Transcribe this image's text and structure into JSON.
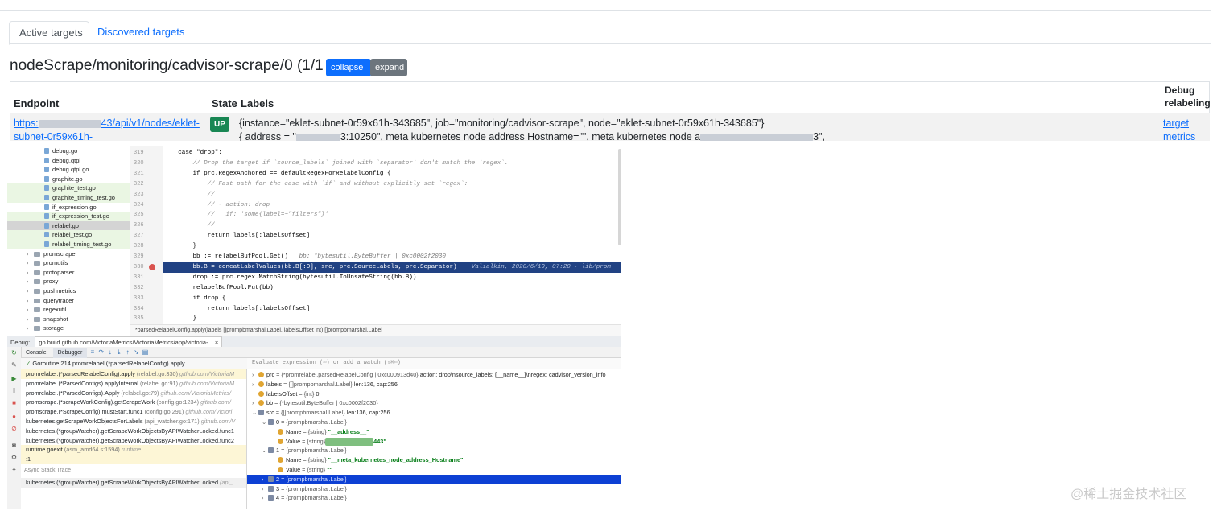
{
  "page": {
    "tabs": [
      {
        "label": "Active targets"
      },
      {
        "label": "Discovered targets"
      }
    ],
    "heading": "nodeScrape/monitoring/cadvisor-scrape/0 (1/1 up)",
    "collapse_label": "collapse",
    "expand_label": "expand",
    "table": {
      "headers": [
        "Endpoint",
        "State",
        "Labels",
        "Debug relabeling"
      ],
      "endpoint_line1_pre": "https:",
      "endpoint_line1_post": "43/api/v1/nodes/eklet-",
      "endpoint_line2": "subnet-0r59x61h-",
      "state": "UP",
      "labels_line1": "{instance=\"eklet-subnet-0r59x61h-343685\", job=\"monitoring/cadvisor-scrape\", node=\"eklet-subnet-0r59x61h-343685\"}",
      "labels_line2_a": "{   address   = \"",
      "labels_line2_b": "3:10250\",    meta kubernetes node address Hostname=\"\",    meta kubernetes node a",
      "labels_line2_c": "3\",",
      "debug_line1": "target",
      "debug_line2": "metrics"
    }
  },
  "ide": {
    "tree": [
      {
        "name": "debug.go",
        "kind": "file",
        "style": ""
      },
      {
        "name": "debug.qtpl",
        "kind": "file",
        "style": ""
      },
      {
        "name": "debug.qtpl.go",
        "kind": "file",
        "style": ""
      },
      {
        "name": "graphite.go",
        "kind": "file",
        "style": ""
      },
      {
        "name": "graphite_test.go",
        "kind": "file",
        "style": "test"
      },
      {
        "name": "graphite_timing_test.go",
        "kind": "file",
        "style": "test"
      },
      {
        "name": "if_expression.go",
        "kind": "file",
        "style": ""
      },
      {
        "name": "if_expression_test.go",
        "kind": "file",
        "style": "test"
      },
      {
        "name": "relabel.go",
        "kind": "file",
        "style": "sel"
      },
      {
        "name": "relabel_test.go",
        "kind": "file",
        "style": "test"
      },
      {
        "name": "relabel_timing_test.go",
        "kind": "file",
        "style": "test"
      },
      {
        "name": "promscrape",
        "kind": "dir",
        "style": ""
      },
      {
        "name": "promutils",
        "kind": "dir",
        "style": ""
      },
      {
        "name": "protoparser",
        "kind": "dir",
        "style": ""
      },
      {
        "name": "proxy",
        "kind": "dir",
        "style": ""
      },
      {
        "name": "pushmetrics",
        "kind": "dir",
        "style": ""
      },
      {
        "name": "querytracer",
        "kind": "dir",
        "style": ""
      },
      {
        "name": "regexutil",
        "kind": "dir",
        "style": ""
      },
      {
        "name": "snapshot",
        "kind": "dir",
        "style": ""
      },
      {
        "name": "storage",
        "kind": "dir",
        "style": ""
      }
    ],
    "line_numbers": [
      "319",
      "320",
      "321",
      "322",
      "323",
      "324",
      "325",
      "326",
      "327",
      "328",
      "329",
      "330",
      "331",
      "332",
      "333",
      "334",
      "335"
    ],
    "code": [
      {
        "text": "    case \"drop\":",
        "cls": "mixed"
      },
      {
        "text": "        // Drop the target if `source_labels` joined with `separator` don't match the `regex`.",
        "cls": "cm"
      },
      {
        "text": "        if prc.RegexAnchored == defaultRegexForRelabelConfig {",
        "cls": "mixed"
      },
      {
        "text": "            // Fast path for the case with `if` and without explicitly set `regex`:",
        "cls": "cm"
      },
      {
        "text": "            //",
        "cls": "cm"
      },
      {
        "text": "            // - action: drop",
        "cls": "cm"
      },
      {
        "text": "            //   if: 'some{label=~\"filters\"}'",
        "cls": "cm"
      },
      {
        "text": "            //",
        "cls": "cm"
      },
      {
        "text": "            return labels[:labelsOffset]",
        "cls": "mixed"
      },
      {
        "text": "        }",
        "cls": "mixed"
      },
      {
        "text": "        bb := relabelBufPool.Get()",
        "cls": "mixed",
        "inline": "   bb: *bytesutil.ByteBuffer | 0xc0002f2030"
      },
      {
        "text": "        bb.B = concatLabelValues(bb.B[:0], src, prc.SourceLabels, prc.Separator)",
        "cls": "hl",
        "inline": "    Valialkin, 2020/6/19, 07:20 · lib/prom"
      },
      {
        "text": "        drop := prc.regex.MatchString(bytesutil.ToUnsafeString(bb.B))",
        "cls": "mixed"
      },
      {
        "text": "        relabelBufPool.Put(bb)",
        "cls": "mixed"
      },
      {
        "text": "        if drop {",
        "cls": "mixed"
      },
      {
        "text": "            return labels[:labelsOffset]",
        "cls": "mixed"
      },
      {
        "text": "        }",
        "cls": "mixed"
      }
    ],
    "breadcrumb": "*parsedRelabelConfig.apply(labels []prompbmarshal.Label, labelsOffset int) []prompbmarshal.Label",
    "debug_label": "Debug:",
    "debug_tab": "go build github.com/VictoriaMetrics/VictoriaMetrics/app/victoria-...",
    "debug_tab_close": "×",
    "console_label": "Console",
    "debugger_label": "Debugger",
    "goroutine": "Goroutine 214 promrelabel.(*parsedRelabelConfig).apply",
    "frames": [
      {
        "fn": "promrelabel.(*parsedRelabelConfig).apply",
        "loc": "(relabel.go:330)",
        "pkg": "github.com/VictoriaM"
      },
      {
        "fn": "promrelabel.(*ParsedConfigs).applyInternal",
        "loc": "(relabel.go:91)",
        "pkg": "github.com/VictoriaM"
      },
      {
        "fn": "promrelabel.(*ParsedConfigs).Apply",
        "loc": "(relabel.go:79)",
        "pkg": "github.com/VictoriaMetrics/"
      },
      {
        "fn": "promscrape.(*scrapeWorkConfig).getScrapeWork",
        "loc": "(config.go:1234)",
        "pkg": "github.com/"
      },
      {
        "fn": "promscrape.(*ScrapeConfig).mustStart.func1",
        "loc": "(config.go:291)",
        "pkg": "github.com/Victori"
      },
      {
        "fn": "kubernetes.getScrapeWorkObjectsForLabels",
        "loc": "(api_watcher.go:171)",
        "pkg": "github.com/V"
      },
      {
        "fn": "kubernetes.(*groupWatcher).getScrapeWorkObjectsByAPIWatcherLocked.func1",
        "loc": "",
        "pkg": ""
      },
      {
        "fn": "kubernetes.(*groupWatcher).getScrapeWorkObjectsByAPIWatcherLocked.func2",
        "loc": "",
        "pkg": ""
      },
      {
        "fn": "runtime.goexit",
        "loc": "(asm_amd64.s:1594)",
        "pkg": "runtime"
      },
      {
        "fn": ":1",
        "loc": "",
        "pkg": ""
      }
    ],
    "async_label": "Async Stack Trace",
    "async_frame": "kubernetes.(*groupWatcher).getScrapeWorkObjectsByAPIWatcherLocked",
    "async_frame_pkg": "(api_",
    "eval_placeholder": "Evaluate expression (⏎) or add a watch (⇧⌘⏎)",
    "variables": [
      {
        "indent": 0,
        "arrow": "›",
        "icon": "var",
        "name": "prc",
        "type": " = {*promrelabel.parsedRelabelConfig | 0xc000913d40}",
        "val": " action: drop\\nsource_labels: [__name__]\\nregex: cadvisor_version_info",
        "sel": false,
        "strval": false
      },
      {
        "indent": 0,
        "arrow": "›",
        "icon": "var",
        "name": "labels",
        "type": " = {[]prompbmarshal.Label}",
        "val": " len:136, cap:256",
        "sel": false,
        "strval": false
      },
      {
        "indent": 0,
        "arrow": "",
        "icon": "var",
        "name": "labelsOffset",
        "type": " = {int}",
        "val": " 0",
        "sel": false,
        "strval": false
      },
      {
        "indent": 0,
        "arrow": "›",
        "icon": "var",
        "name": "bb",
        "type": " = {*bytesutil.ByteBuffer | 0xc0002f2030}",
        "val": "",
        "sel": false,
        "strval": false
      },
      {
        "indent": 0,
        "arrow": "⌄",
        "icon": "arr",
        "name": "src",
        "type": " = {[]prompbmarshal.Label}",
        "val": " len:136, cap:256",
        "sel": false,
        "strval": false
      },
      {
        "indent": 1,
        "arrow": "⌄",
        "icon": "arr",
        "name": "0",
        "type": " = {prompbmarshal.Label}",
        "val": "",
        "sel": false,
        "strval": false
      },
      {
        "indent": 2,
        "arrow": "",
        "icon": "var",
        "name": "Name",
        "type": " = {string}",
        "val": " \"__address__\"",
        "sel": false,
        "strval": true
      },
      {
        "indent": 2,
        "arrow": "",
        "icon": "var",
        "name": "Value",
        "type": " = {string}",
        "val": "443\"",
        "sel": false,
        "strval": true,
        "blur": true
      },
      {
        "indent": 1,
        "arrow": "⌄",
        "icon": "arr",
        "name": "1",
        "type": " = {prompbmarshal.Label}",
        "val": "",
        "sel": false,
        "strval": false
      },
      {
        "indent": 2,
        "arrow": "",
        "icon": "var",
        "name": "Name",
        "type": " = {string}",
        "val": " \"__meta_kubernetes_node_address_Hostname\"",
        "sel": false,
        "strval": true
      },
      {
        "indent": 2,
        "arrow": "",
        "icon": "var",
        "name": "Value",
        "type": " = {string}",
        "val": " \"\"",
        "sel": false,
        "strval": true
      },
      {
        "indent": 1,
        "arrow": "›",
        "icon": "arr",
        "name": "2",
        "type": " = {prompbmarshal.Label}",
        "val": "",
        "sel": true,
        "strval": false
      },
      {
        "indent": 1,
        "arrow": "›",
        "icon": "arr",
        "name": "3",
        "type": " = {prompbmarshal.Label}",
        "val": "",
        "sel": false,
        "strval": false
      },
      {
        "indent": 1,
        "arrow": "›",
        "icon": "arr",
        "name": "4",
        "type": " = {prompbmarshal.Label}",
        "val": "",
        "sel": false,
        "strval": false
      }
    ]
  },
  "watermark": "@稀土掘金技术社区",
  "colors": {
    "accent": "#0d6efd",
    "success": "#198754",
    "selection": "#0d40d4",
    "code_highlight": "#214283"
  }
}
